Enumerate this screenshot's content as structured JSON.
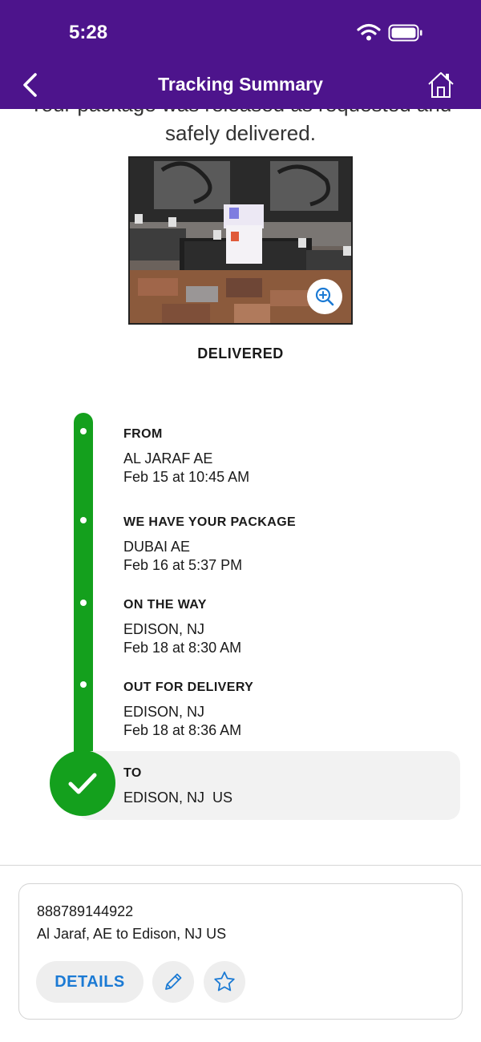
{
  "status_bar": {
    "time": "5:28"
  },
  "header": {
    "title": "Tracking Summary"
  },
  "headline": {
    "line1": "Your package was released as requested and",
    "line2": "safely delivered."
  },
  "status": {
    "label": "DELIVERED"
  },
  "timeline": [
    {
      "title": "FROM",
      "location": "AL JARAF AE",
      "time": "Feb 15 at 10:45 AM"
    },
    {
      "title": "WE HAVE YOUR PACKAGE",
      "location": "DUBAI AE",
      "time": "Feb 16 at 5:37 PM"
    },
    {
      "title": "ON THE WAY",
      "location": "EDISON, NJ",
      "time": "Feb 18 at 8:30 AM"
    },
    {
      "title": "OUT FOR DELIVERY",
      "location": "EDISON, NJ",
      "time": "Feb 18 at 8:36 AM"
    },
    {
      "title": "TO",
      "location": "EDISON, NJ  US"
    }
  ],
  "card": {
    "tracking_number": "888789144922",
    "route": "Al Jaraf, AE to Edison, NJ US",
    "details_label": "DETAILS"
  },
  "colors": {
    "brand": "#4d148c",
    "progress": "#14a01d",
    "link": "#1b7ad4"
  }
}
